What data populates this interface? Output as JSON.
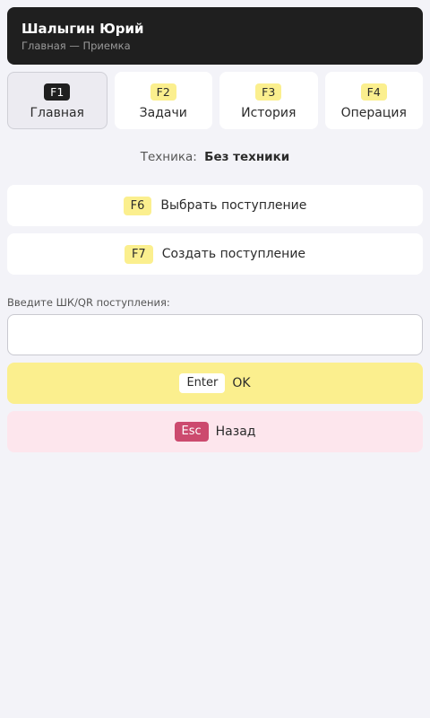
{
  "header": {
    "user_name": "Шалыгин Юрий",
    "breadcrumb": "Главная — Приемка"
  },
  "tabs": [
    {
      "key": "F1",
      "label": "Главная",
      "active": true
    },
    {
      "key": "F2",
      "label": "Задачи",
      "active": false
    },
    {
      "key": "F3",
      "label": "История",
      "active": false
    },
    {
      "key": "F4",
      "label": "Операция",
      "active": false
    }
  ],
  "equipment": {
    "label": "Техника:",
    "value": "Без техники"
  },
  "actions": {
    "select": {
      "key": "F6",
      "label": "Выбрать поступление"
    },
    "create": {
      "key": "F7",
      "label": "Создать поступление"
    }
  },
  "barcode": {
    "label": "Введите ШК/QR поступления:",
    "value": "",
    "placeholder": ""
  },
  "ok_button": {
    "key": "Enter",
    "label": "OK"
  },
  "back_button": {
    "key": "Esc",
    "label": "Назад"
  },
  "colors": {
    "accent_yellow": "#fbef8e",
    "danger_pink": "#fde6ed",
    "esc_badge": "#cc4a6e",
    "header_bg": "#1f1f1f",
    "page_bg": "#f3f3f8"
  }
}
